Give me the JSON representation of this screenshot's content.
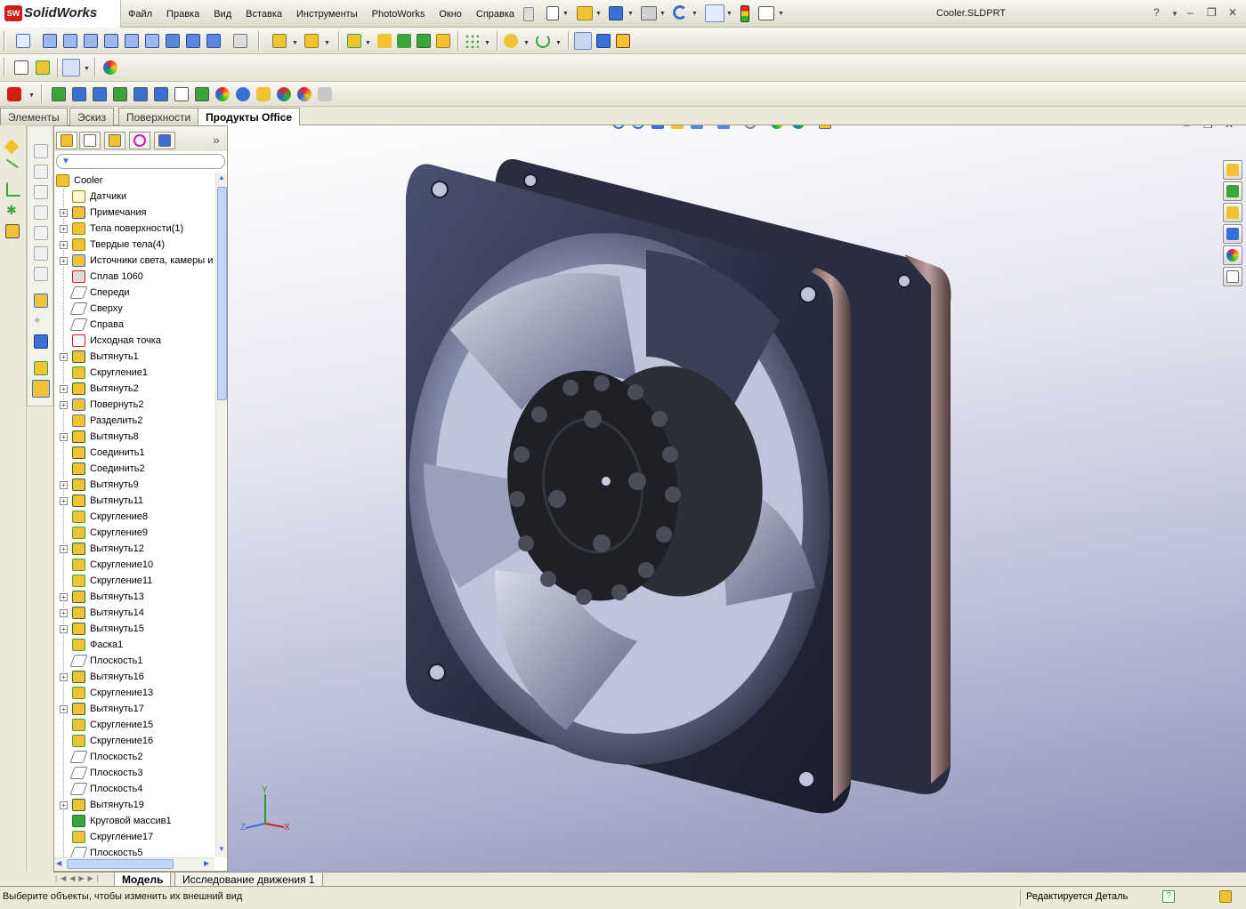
{
  "app": {
    "name": "SolidWorks",
    "logo_text": "SW"
  },
  "title_bar": {
    "filename": "Cooler.SLDPRT",
    "help": "?",
    "minimize": "–",
    "restore": "❐",
    "close": "✕"
  },
  "menu": [
    "Файл",
    "Правка",
    "Вид",
    "Вставка",
    "Инструменты",
    "PhotoWorks",
    "Окно",
    "Справка"
  ],
  "command_tabs": [
    {
      "label": "Элементы",
      "active": false
    },
    {
      "label": "Эскиз",
      "active": false
    },
    {
      "label": "Поверхности",
      "active": false
    },
    {
      "label": "Продукты Office",
      "active": true
    }
  ],
  "feature_tree": {
    "collapse_label": "»",
    "root": "Cooler",
    "items": [
      {
        "label": "Датчики",
        "expandable": false,
        "icon": "sensor-icon"
      },
      {
        "label": "Примечания",
        "expandable": true,
        "icon": "annotation-icon"
      },
      {
        "label": "Тела поверхности(1)",
        "expandable": true,
        "icon": "surface-body-icon"
      },
      {
        "label": "Твердые тела(4)",
        "expandable": true,
        "icon": "solid-body-icon"
      },
      {
        "label": "Источники света, камеры и",
        "expandable": true,
        "icon": "lights-icon"
      },
      {
        "label": "Сплав 1060",
        "expandable": false,
        "icon": "material-icon"
      },
      {
        "label": "Спереди",
        "expandable": false,
        "icon": "plane-icon"
      },
      {
        "label": "Сверху",
        "expandable": false,
        "icon": "plane-icon"
      },
      {
        "label": "Справа",
        "expandable": false,
        "icon": "plane-icon"
      },
      {
        "label": "Исходная точка",
        "expandable": false,
        "icon": "origin-icon"
      },
      {
        "label": "Вытянуть1",
        "expandable": true,
        "icon": "extrude-icon"
      },
      {
        "label": "Скругление1",
        "expandable": false,
        "icon": "fillet-icon"
      },
      {
        "label": "Вытянуть2",
        "expandable": true,
        "icon": "extrude-icon"
      },
      {
        "label": "Повернуть2",
        "expandable": true,
        "icon": "revolve-icon"
      },
      {
        "label": "Разделить2",
        "expandable": false,
        "icon": "split-icon"
      },
      {
        "label": "Вытянуть8",
        "expandable": true,
        "icon": "extrude-icon"
      },
      {
        "label": "Соединить1",
        "expandable": false,
        "icon": "combine-icon"
      },
      {
        "label": "Соединить2",
        "expandable": false,
        "icon": "combine-icon"
      },
      {
        "label": "Вытянуть9",
        "expandable": true,
        "icon": "extrude-icon"
      },
      {
        "label": "Вытянуть11",
        "expandable": true,
        "icon": "extrude-icon"
      },
      {
        "label": "Скругление8",
        "expandable": false,
        "icon": "fillet-icon"
      },
      {
        "label": "Скругление9",
        "expandable": false,
        "icon": "fillet-icon"
      },
      {
        "label": "Вытянуть12",
        "expandable": true,
        "icon": "extrude-icon"
      },
      {
        "label": "Скругление10",
        "expandable": false,
        "icon": "fillet-icon"
      },
      {
        "label": "Скругление11",
        "expandable": false,
        "icon": "fillet-icon"
      },
      {
        "label": "Вытянуть13",
        "expandable": true,
        "icon": "extrude-icon"
      },
      {
        "label": "Вытянуть14",
        "expandable": true,
        "icon": "extrude-icon"
      },
      {
        "label": "Вытянуть15",
        "expandable": true,
        "icon": "extrude-icon"
      },
      {
        "label": "Фаска1",
        "expandable": false,
        "icon": "chamfer-icon"
      },
      {
        "label": "Плоскость1",
        "expandable": false,
        "icon": "plane-icon"
      },
      {
        "label": "Вытянуть16",
        "expandable": true,
        "icon": "extrude-icon"
      },
      {
        "label": "Скругление13",
        "expandable": false,
        "icon": "fillet-icon"
      },
      {
        "label": "Вытянуть17",
        "expandable": true,
        "icon": "extrude-icon"
      },
      {
        "label": "Скругление15",
        "expandable": false,
        "icon": "fillet-icon"
      },
      {
        "label": "Скругление16",
        "expandable": false,
        "icon": "fillet-icon"
      },
      {
        "label": "Плоскость2",
        "expandable": false,
        "icon": "plane-icon"
      },
      {
        "label": "Плоскость3",
        "expandable": false,
        "icon": "plane-icon"
      },
      {
        "label": "Плоскость4",
        "expandable": false,
        "icon": "plane-icon"
      },
      {
        "label": "Вытянуть19",
        "expandable": true,
        "icon": "extrude-icon"
      },
      {
        "label": "Круговой массив1",
        "expandable": false,
        "icon": "circular-pattern-icon"
      },
      {
        "label": "Скругление17",
        "expandable": false,
        "icon": "fillet-icon"
      },
      {
        "label": "Плоскость5",
        "expandable": false,
        "icon": "plane-icon"
      }
    ]
  },
  "viewport": {
    "model": "Cooler",
    "triad": {
      "x": "X",
      "y": "Y",
      "z": "Z"
    },
    "close": "✕",
    "minimize": "–",
    "restore": "❐"
  },
  "bottom_tabs": [
    {
      "label": "Модель",
      "active": true
    },
    {
      "label": "Исследование движения 1",
      "active": false
    }
  ],
  "status": {
    "message": "Выберите объекты, чтобы изменить их внешний вид",
    "mode": "Редактируется Деталь"
  },
  "colors": {
    "accent_red": "#d21c1c",
    "icon_yellow": "#f1c232",
    "icon_green": "#3aa63a",
    "icon_blue": "#3b6fd6",
    "fan_dark": "#262a3c"
  }
}
